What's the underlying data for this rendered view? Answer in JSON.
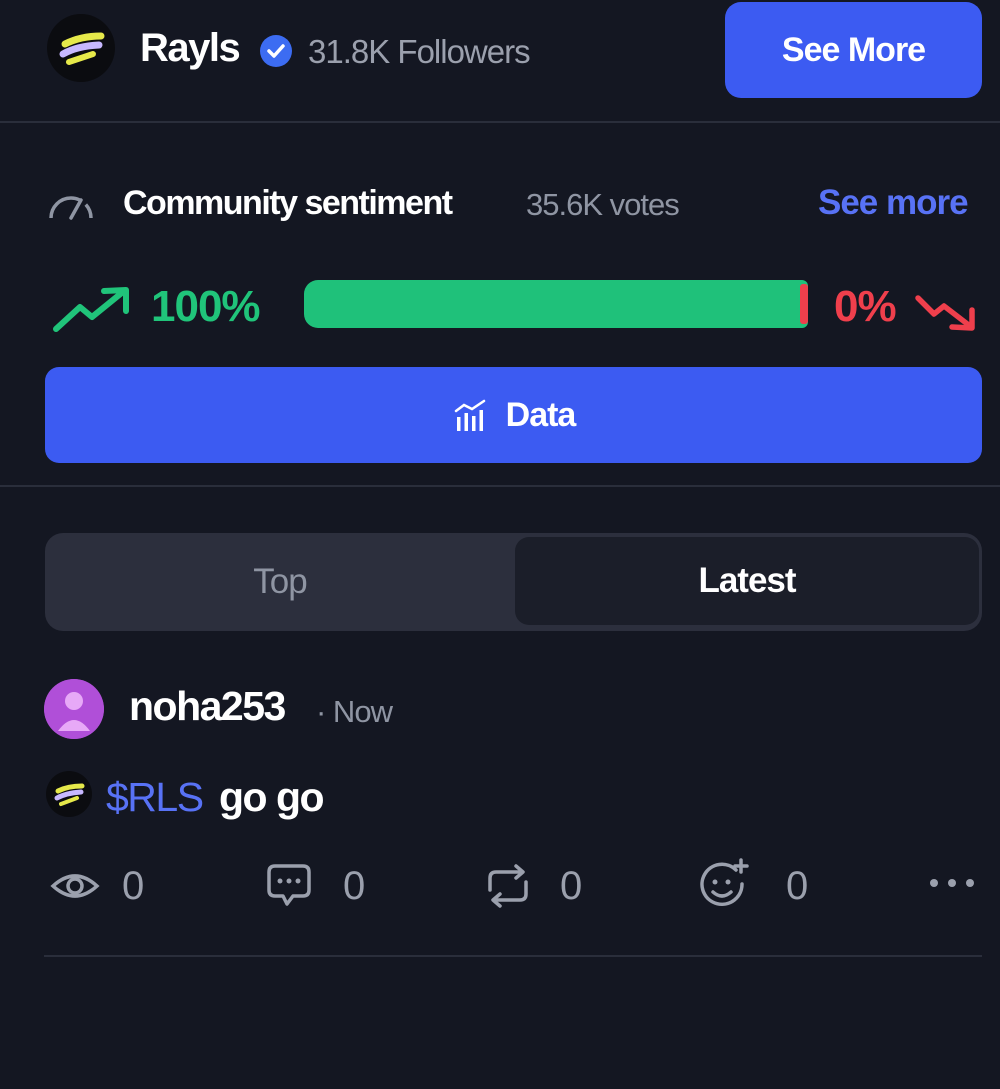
{
  "project": {
    "name": "Rayls",
    "followers": "31.8K Followers",
    "see_more_button": "See More"
  },
  "sentiment": {
    "title": "Community sentiment",
    "votes": "35.6K votes",
    "see_more_link": "See more",
    "bullish_label": "100%",
    "bearish_label": "0%",
    "bullish_fraction": 0.985,
    "bullish_color": "#1fc17a",
    "bearish_color": "#ef3f4c",
    "data_button": "Data"
  },
  "tabs": [
    {
      "label": "Top",
      "active": false
    },
    {
      "label": "Latest",
      "active": true
    }
  ],
  "post": {
    "username": "noha253",
    "time": "· Now",
    "ticker": "$RLS",
    "text": "go go",
    "views": "0",
    "comments": "0",
    "reposts": "0",
    "reactions": "0"
  },
  "colors": {
    "background": "#141722",
    "accent": "#3c5bf2",
    "link": "#5872f5"
  },
  "icons": [
    "rayls-logo",
    "verified-icon",
    "gauge-icon",
    "trend-up-icon",
    "trend-down-icon",
    "bar-chart-icon",
    "avatar",
    "eye-icon",
    "comment-icon",
    "repost-icon",
    "emoji-add-icon",
    "more-icon"
  ]
}
